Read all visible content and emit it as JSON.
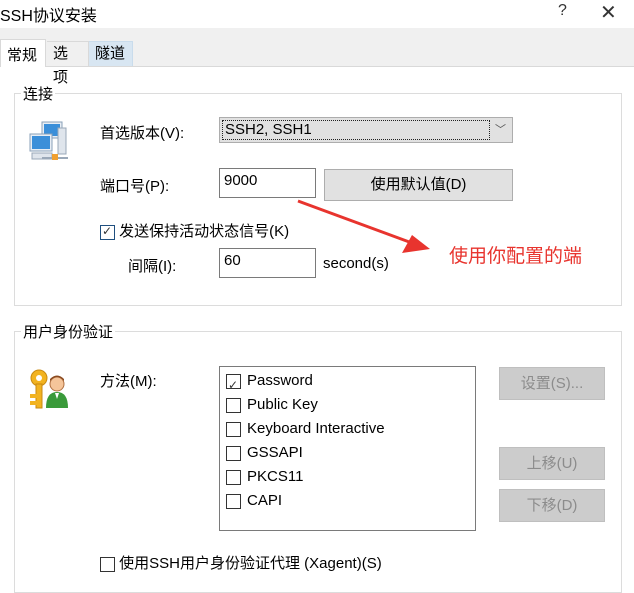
{
  "window": {
    "title": "SSH协议安装",
    "help_glyph": "?",
    "close_glyph": "✕"
  },
  "tabs": [
    {
      "label": "常规",
      "active": true
    },
    {
      "label": "选项",
      "active": false
    },
    {
      "label": "隧道",
      "active": false,
      "hovered": true
    }
  ],
  "connection": {
    "legend": "连接",
    "icon": "network-computers-icon",
    "version_label": "首选版本(V):",
    "version_value": "SSH2, SSH1",
    "port_label": "端口号(P):",
    "port_value": "9000",
    "default_button": "使用默认值(D)",
    "keepalive_label": "发送保持活动状态信号(K)",
    "keepalive_checked": true,
    "interval_label": "间隔(I):",
    "interval_value": "60",
    "interval_unit": "second(s)"
  },
  "annotation": {
    "text": "使用你配置的端",
    "color": "#e8342e"
  },
  "auth": {
    "legend": "用户身份验证",
    "icon": "key-user-icon",
    "method_label": "方法(M):",
    "methods": [
      {
        "label": "Password",
        "checked": true
      },
      {
        "label": "Public Key",
        "checked": false
      },
      {
        "label": "Keyboard Interactive",
        "checked": false
      },
      {
        "label": "GSSAPI",
        "checked": false
      },
      {
        "label": "PKCS11",
        "checked": false
      },
      {
        "label": "CAPI",
        "checked": false
      }
    ],
    "settings_button": "设置(S)...",
    "move_up_button": "上移(U)",
    "move_down_button": "下移(D)",
    "agent_label": "使用SSH用户身份验证代理 (Xagent)(S)",
    "agent_checked": false
  }
}
